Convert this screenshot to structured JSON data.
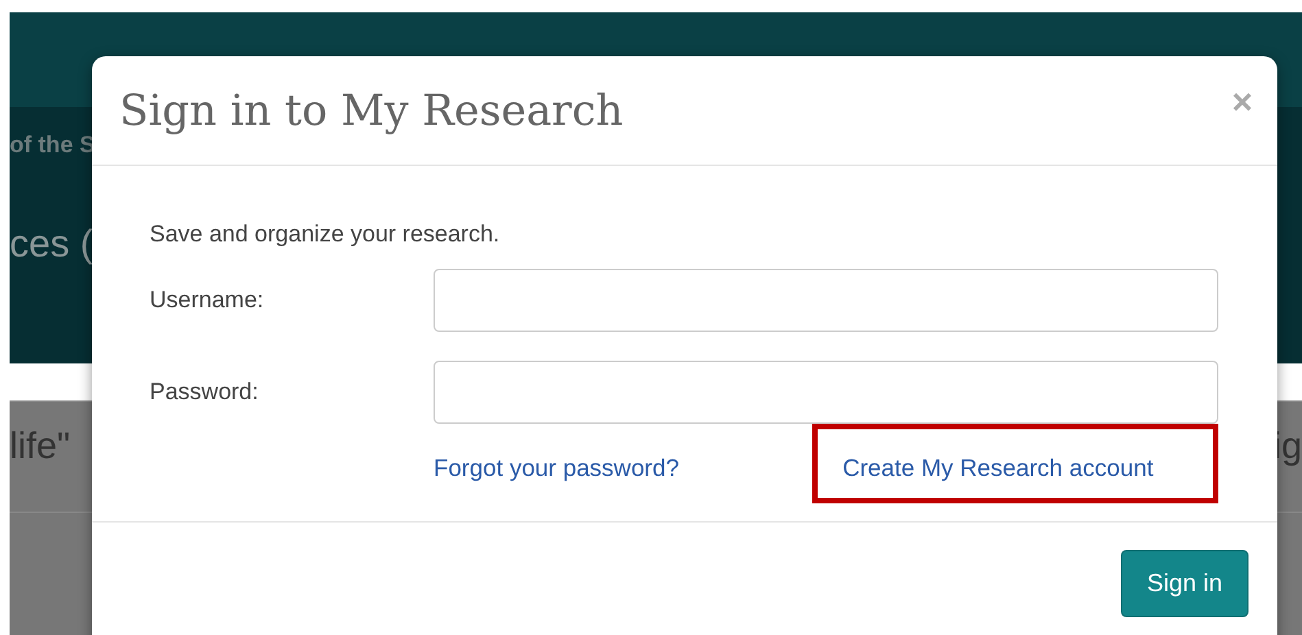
{
  "background": {
    "header_texts": [
      {
        "text": "of the S"
      },
      {
        "text": "ces ("
      }
    ],
    "content_texts": [
      {
        "text": "life\""
      },
      {
        "text": "ig"
      }
    ]
  },
  "modal": {
    "title": "Sign in to My Research",
    "close": "×",
    "intro": "Save and organize your research.",
    "fields": [
      {
        "label": "Username:"
      },
      {
        "label": "Password:"
      }
    ],
    "links": [
      {
        "text": "Forgot your password?",
        "highlighted": false
      },
      {
        "text": "Create My Research account",
        "highlighted": true
      }
    ],
    "button": "Sign in"
  }
}
